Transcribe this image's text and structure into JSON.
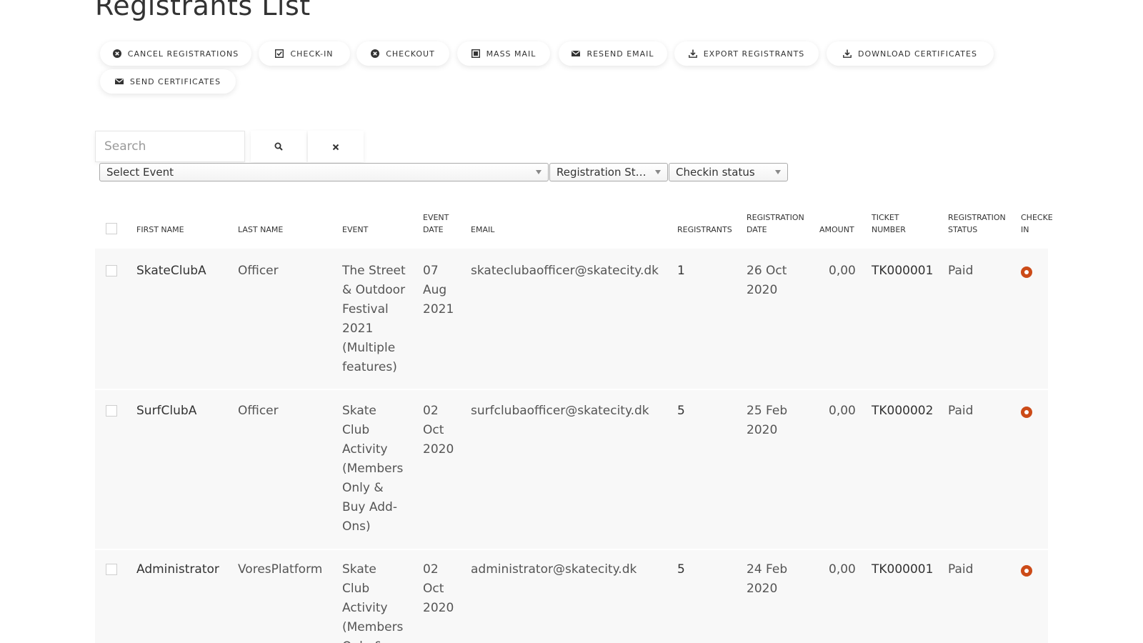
{
  "page": {
    "title": "Registrants List"
  },
  "colors": {
    "accent": "#cc4b18",
    "row_bg": "#f8f8f8"
  },
  "toolbar": {
    "buttons": [
      {
        "label": "CANCEL REGISTRATIONS",
        "icon": "x-circle-icon"
      },
      {
        "label": "CHECK-IN",
        "icon": "checkbox-checked-icon"
      },
      {
        "label": "CHECKOUT",
        "icon": "x-circle-icon"
      },
      {
        "label": "MASS MAIL",
        "icon": "square-icon"
      },
      {
        "label": "RESEND EMAIL",
        "icon": "envelope-icon"
      },
      {
        "label": "EXPORT REGISTRANTS",
        "icon": "download-icon"
      },
      {
        "label": "DOWNLOAD CERTIFICATES",
        "icon": "download-icon"
      },
      {
        "label": "SEND CERTIFICATES",
        "icon": "envelope-icon"
      }
    ]
  },
  "filters": {
    "search_placeholder": "Search",
    "search_icon": "search-icon",
    "clear_icon": "close-icon",
    "event_select": "Select Event",
    "registration_status_select": "Registration Stat...",
    "checkin_status_select": "Checkin status"
  },
  "table": {
    "headers": {
      "first_name": "FIRST NAME",
      "last_name": "LAST NAME",
      "event": "EVENT",
      "event_date_1": "EVENT",
      "event_date_2": "DATE",
      "email": "EMAIL",
      "registrants": "REGISTRANTS",
      "registration_date_1": "REGISTRATION",
      "registration_date_2": "DATE",
      "amount": "AMOUNT",
      "ticket_number_1": "TICKET",
      "ticket_number_2": "NUMBER",
      "registration_status_1": "REGISTRATION",
      "registration_status_2": "STATUS",
      "checked_in_1": "CHECKE",
      "checked_in_2": "IN"
    },
    "rows": [
      {
        "first_name": "SkateClubA",
        "last_name": "Officer",
        "event_lines": [
          "The Street",
          "& Outdoor",
          "Festival",
          "2021",
          "(Multiple",
          "features)"
        ],
        "event_date_lines": [
          "07",
          "Aug",
          "2021"
        ],
        "email": "skateclubaofficer@skatecity.dk",
        "registrants": "1",
        "registration_date_lines": [
          "26 Oct",
          "2020"
        ],
        "amount": "0,00",
        "ticket_number": "TK000001",
        "registration_status": "Paid",
        "checked_in": false
      },
      {
        "first_name": "SurfClubA",
        "last_name": "Officer",
        "event_lines": [
          "Skate",
          "Club",
          "Activity",
          "(Members",
          "Only &",
          "Buy Add-",
          "Ons)"
        ],
        "event_date_lines": [
          "02",
          "Oct",
          "2020"
        ],
        "email": "surfclubaofficer@skatecity.dk",
        "registrants": "5",
        "registration_date_lines": [
          "25 Feb",
          "2020"
        ],
        "amount": "0,00",
        "ticket_number": "TK000002",
        "registration_status": "Paid",
        "checked_in": false
      },
      {
        "first_name": "Administrator",
        "last_name": "VoresPlatform",
        "event_lines": [
          "Skate",
          "Club",
          "Activity",
          "(Members",
          "Only &"
        ],
        "event_date_lines": [
          "02",
          "Oct",
          "2020"
        ],
        "email": "administrator@skatecity.dk",
        "registrants": "5",
        "registration_date_lines": [
          "24 Feb",
          "2020"
        ],
        "amount": "0,00",
        "ticket_number": "TK000001",
        "registration_status": "Paid",
        "checked_in": false
      }
    ]
  }
}
